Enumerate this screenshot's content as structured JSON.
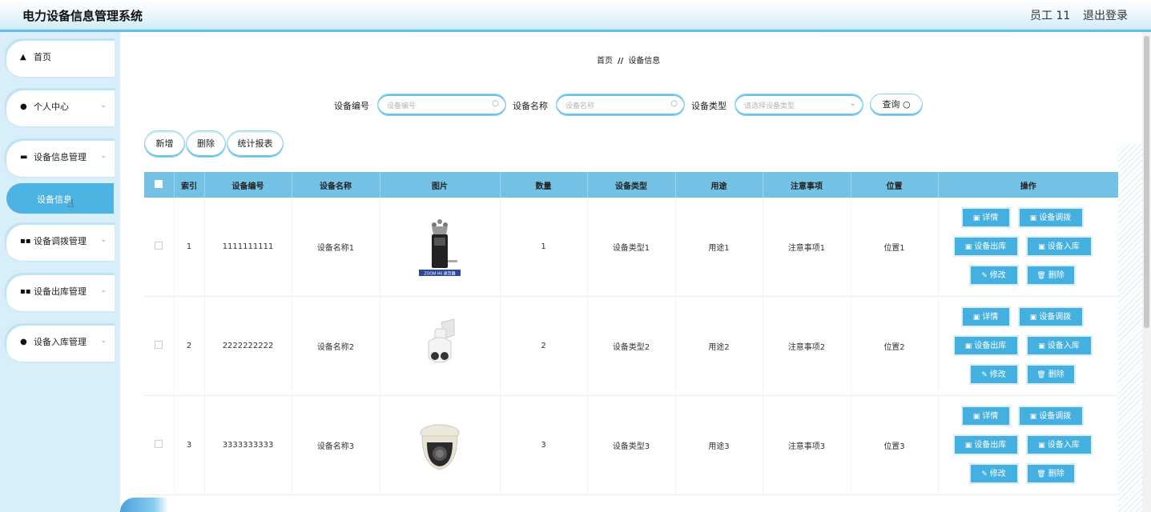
{
  "header": {
    "title": "电力设备信息管理系统",
    "user": "员工 11",
    "logout": "退出登录"
  },
  "sidebar": {
    "items": [
      {
        "label": "首页",
        "icon": "home-icon"
      },
      {
        "label": "个人中心",
        "icon": "user-icon"
      },
      {
        "label": "设备信息管理",
        "icon": "message-icon"
      },
      {
        "label": "设备调拨管理",
        "icon": "grid-icon"
      },
      {
        "label": "设备出库管理",
        "icon": "grid-icon"
      },
      {
        "label": "设备入库管理",
        "icon": "user-icon"
      }
    ],
    "active_sub": "设备信息"
  },
  "breadcrumb": {
    "home": "首页",
    "sep": "//",
    "current": "设备信息"
  },
  "search": {
    "code_label": "设备编号",
    "code_placeholder": "设备编号",
    "name_label": "设备名称",
    "name_placeholder": "设备名称",
    "type_label": "设备类型",
    "type_placeholder": "请选择设备类型",
    "query": "查询"
  },
  "toolbar": {
    "add": "新增",
    "delete": "删除",
    "report": "统计报表"
  },
  "table": {
    "headers": [
      "索引",
      "设备编号",
      "设备名称",
      "图片",
      "数量",
      "设备类型",
      "用途",
      "注意事项",
      "位置",
      "操作"
    ],
    "rows": [
      {
        "index": "1",
        "code": "1111111111",
        "name": "设备名称1",
        "image": "recorder",
        "caption": "ZOOM H6 录音器",
        "qty": "1",
        "type": "设备类型1",
        "use": "用途1",
        "notes": "注意事项1",
        "location": "位置1"
      },
      {
        "index": "2",
        "code": "2222222222",
        "name": "设备名称2",
        "image": "ptz-camera",
        "qty": "2",
        "type": "设备类型2",
        "use": "用途2",
        "notes": "注意事项2",
        "location": "位置2"
      },
      {
        "index": "3",
        "code": "3333333333",
        "name": "设备名称3",
        "image": "dome-camera",
        "qty": "3",
        "type": "设备类型3",
        "use": "用途3",
        "notes": "注意事项3",
        "location": "位置3"
      }
    ],
    "actions": {
      "detail": "详情",
      "transfer": "设备调拨",
      "outbound": "设备出库",
      "inbound": "设备入库",
      "edit": "修改",
      "remove": "删除"
    }
  }
}
